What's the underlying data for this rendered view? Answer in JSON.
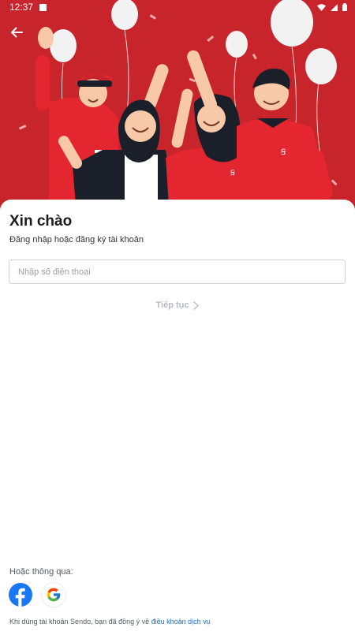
{
  "status_bar": {
    "time": "12:37"
  },
  "header": {
    "back_icon": "arrow-left-icon"
  },
  "colors": {
    "hero_bg": "#c8242b",
    "brand_red": "#e3262f",
    "link_blue": "#1f6fd1"
  },
  "login": {
    "title": "Xin chào",
    "subtitle": "Đăng nhập hoặc đăng ký tài khoản",
    "phone_placeholder": "Nhập số điện thoại",
    "continue_label": "Tiếp tục",
    "alt_login_label": "Hoặc thông qua:",
    "social_buttons": [
      {
        "name": "Facebook",
        "icon": "facebook-icon"
      },
      {
        "name": "Google",
        "icon": "google-icon"
      }
    ],
    "terms_prefix": "Khi dùng tài khoản Sendo, bạn đã đồng ý về ",
    "terms_link": "điều khoản dịch vụ"
  }
}
